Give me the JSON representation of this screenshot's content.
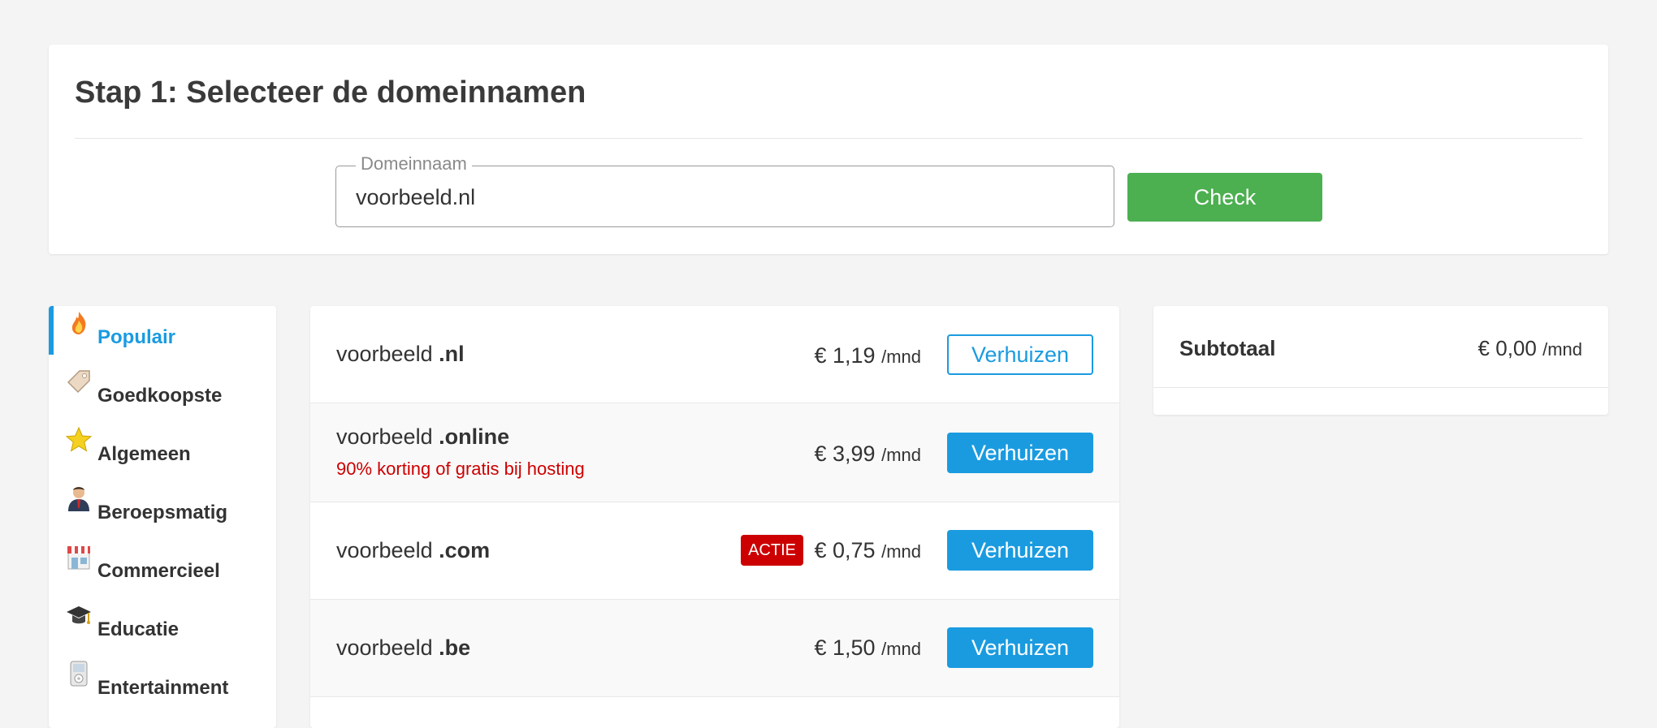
{
  "step": {
    "title": "Stap 1: Selecteer de domeinnamen",
    "domain_field_label": "Domeinnaam",
    "domain_field_value": "voorbeeld.nl",
    "check_label": "Check"
  },
  "categories": [
    {
      "label": "Populair",
      "icon": "flame-icon",
      "active": true
    },
    {
      "label": "Goedkoopste",
      "icon": "price-tag-icon",
      "active": false
    },
    {
      "label": "Algemeen",
      "icon": "star-icon",
      "active": false
    },
    {
      "label": "Beroepsmatig",
      "icon": "businessman-icon",
      "active": false
    },
    {
      "label": "Commercieel",
      "icon": "shop-icon",
      "active": false
    },
    {
      "label": "Educatie",
      "icon": "graduation-cap-icon",
      "active": false
    },
    {
      "label": "Entertainment",
      "icon": "music-player-icon",
      "active": false
    }
  ],
  "domains": [
    {
      "name": "voorbeeld",
      "tld": ".nl",
      "price": "€ 1,19",
      "unit": "/mnd",
      "button": "Verhuizen",
      "button_style": "outline"
    },
    {
      "name": "voorbeeld",
      "tld": ".online",
      "promo": "90% korting of gratis bij hosting",
      "price": "€ 3,99",
      "unit": "/mnd",
      "button": "Verhuizen",
      "button_style": "solid"
    },
    {
      "name": "voorbeeld",
      "tld": ".com",
      "badge": "ACTIE",
      "price": "€ 0,75",
      "unit": "/mnd",
      "button": "Verhuizen",
      "button_style": "solid"
    },
    {
      "name": "voorbeeld",
      "tld": ".be",
      "price": "€ 1,50",
      "unit": "/mnd",
      "button": "Verhuizen",
      "button_style": "solid"
    }
  ],
  "subtotal": {
    "label": "Subtotaal",
    "price": "€ 0,00",
    "unit": "/mnd"
  },
  "colors": {
    "accent_blue": "#1a9be0",
    "check_green": "#4caf50",
    "promo_red": "#cc0000"
  }
}
